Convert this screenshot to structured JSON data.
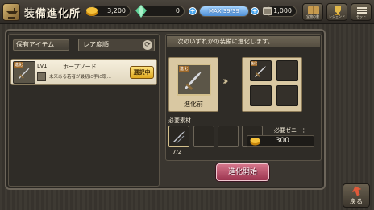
{
  "header": {
    "title": "装備進化所",
    "resources": {
      "gold": "3,200",
      "crystal": "0",
      "stamina": "MAX 39/39",
      "coins": "1,000"
    },
    "buttons": [
      "宝物の書",
      "レジェンド",
      "ゼット"
    ]
  },
  "left_panel": {
    "header": "保有アイテム",
    "sort_label": "レア度順",
    "items": [
      {
        "tag": "進化",
        "level": "Lv1",
        "name": "ホープソード",
        "description": "未来ある若者が最初に手に取…",
        "badge": "選択中"
      }
    ]
  },
  "right_panel": {
    "instruction": "次のいずれかの装備に進化します。",
    "pre_evolution_tag": "進化",
    "pre_evolution_label": "進化前",
    "materials_label": "必要素材",
    "materials_count": "7/2",
    "zeny_label": "必要ゼニー：",
    "zeny_value": "300"
  },
  "actions": {
    "start_label": "進化開始",
    "back_label": "戻る"
  },
  "colors": {
    "select_badge": "#e0a91f",
    "start_button": "#9c3550",
    "max_bar": "#4e8fd6"
  }
}
